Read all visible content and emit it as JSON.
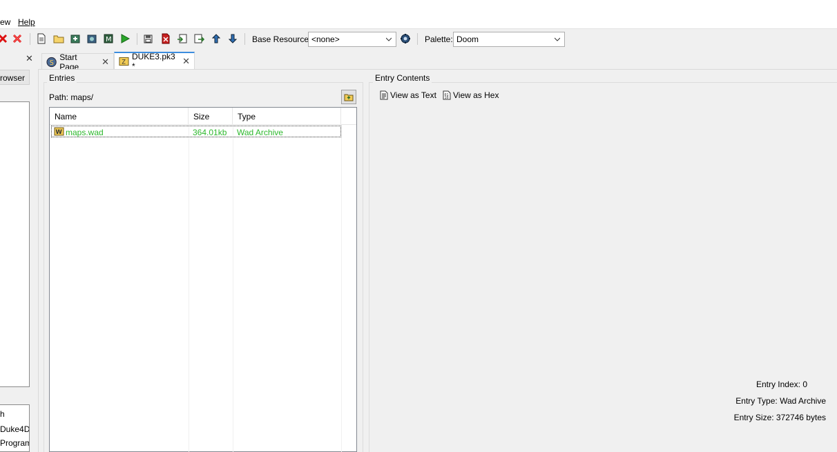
{
  "menu": {
    "view_label": "ew",
    "help_label": "Help"
  },
  "toolbar": {
    "base_resource_label": "Base Resource:",
    "base_resource_value": "<none>",
    "palette_label": "Palette:",
    "palette_value": "Doom"
  },
  "left_panel": {
    "tab_label": "rowser",
    "bottom_items": [
      "h",
      "Duke4D",
      "Program"
    ]
  },
  "tabs": [
    {
      "label": "Start Page"
    },
    {
      "label": "DUKE3.pk3 *"
    }
  ],
  "entries": {
    "group_title": "Entries",
    "path": "Path: maps/",
    "columns": [
      "Name",
      "Size",
      "Type"
    ],
    "rows": [
      {
        "name": "maps.wad",
        "size": "364.01kb",
        "type": "Wad Archive"
      }
    ]
  },
  "entry_contents": {
    "group_title": "Entry Contents",
    "view_as_text": "View as Text",
    "view_as_hex": "View as Hex",
    "entry_index": "Entry Index: 0",
    "entry_type": "Entry Type: Wad Archive",
    "entry_size": "Entry Size: 372746 bytes"
  },
  "colors": {
    "accent": "#3c8dde",
    "entry_text": "#2db82d"
  }
}
